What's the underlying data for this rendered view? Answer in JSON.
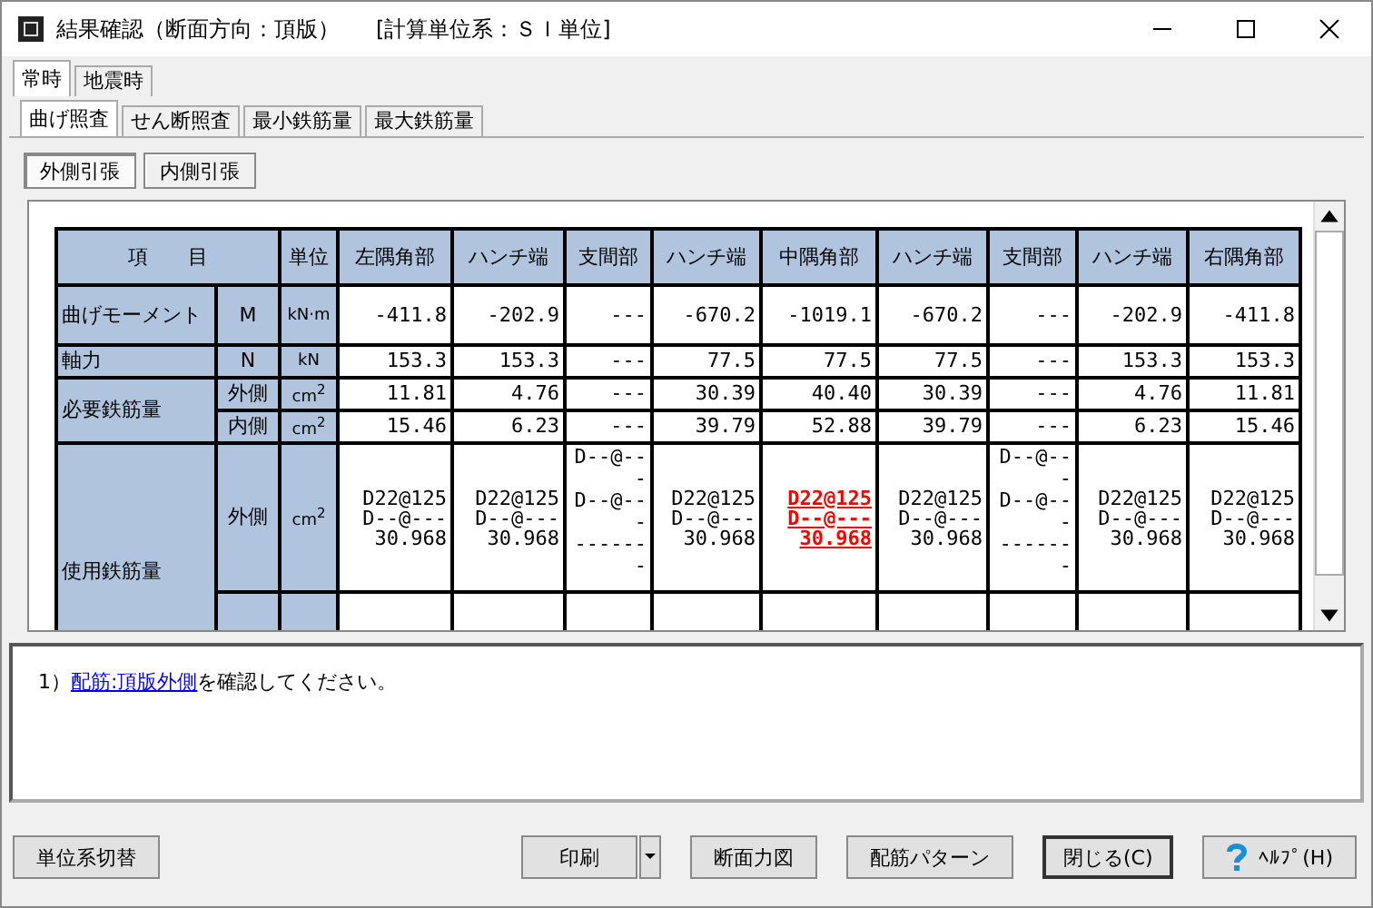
{
  "window": {
    "title": "結果確認（断面方向：頂版）",
    "units_note": "[計算単位系：ＳＩ単位]"
  },
  "tabs": [
    {
      "label": "常時",
      "selected": true
    },
    {
      "label": "地震時",
      "selected": false
    }
  ],
  "subtabs": [
    {
      "label": "曲げ照査",
      "selected": true
    },
    {
      "label": "せん断照査",
      "selected": false
    },
    {
      "label": "最小鉄筋量",
      "selected": false
    },
    {
      "label": "最大鉄筋量",
      "selected": false
    }
  ],
  "toggles": [
    {
      "label": "外側引張",
      "selected": true
    },
    {
      "label": "内側引張",
      "selected": false
    }
  ],
  "table": {
    "item_header": "項　　目",
    "unit_header": "単位",
    "columns": [
      "左隅角部",
      "ハンチ端",
      "支間部",
      "ハンチ端",
      "中隅角部",
      "ハンチ端",
      "支間部",
      "ハンチ端",
      "右隅角部"
    ],
    "groups": [
      {
        "label": "曲げモーメント",
        "subrows": [
          {
            "sub": "M",
            "unit": "kN·m",
            "values": [
              "-411.8",
              "-202.9",
              "---",
              "-670.2",
              "-1019.1",
              "-670.2",
              "---",
              "-202.9",
              "-411.8"
            ]
          }
        ]
      },
      {
        "label": "軸力",
        "subrows": [
          {
            "sub": "N",
            "unit": "kN",
            "values": [
              "153.3",
              "153.3",
              "---",
              "77.5",
              "77.5",
              "77.5",
              "---",
              "153.3",
              "153.3"
            ]
          }
        ]
      },
      {
        "label": "必要鉄筋量",
        "subrows": [
          {
            "sub": "外側",
            "unit": "cm$^{2}$",
            "values": [
              "11.81",
              "4.76",
              "---",
              "30.39",
              "40.40",
              "30.39",
              "---",
              "4.76",
              "11.81"
            ]
          },
          {
            "sub": "内側",
            "unit": "cm$^{2}$",
            "values": [
              "15.46",
              "6.23",
              "---",
              "39.79",
              "52.88",
              "39.79",
              "---",
              "6.23",
              "15.46"
            ]
          }
        ]
      },
      {
        "label": "使用鉄筋量",
        "subrows": [
          {
            "sub": "外側",
            "unit": "cm$^{2}$",
            "values": [
              {
                "lines": [
                  "D22@125",
                  "D--@---",
                  "30.968"
                ],
                "highlight": false
              },
              {
                "lines": [
                  "D22@125",
                  "D--@---",
                  "30.968"
                ],
                "highlight": false
              },
              {
                "lines": [
                  "D--@---",
                  "D--@---",
                  "-------"
                ],
                "highlight": false
              },
              {
                "lines": [
                  "D22@125",
                  "D--@---",
                  "30.968"
                ],
                "highlight": false
              },
              {
                "lines": [
                  "D22@125",
                  "D--@---",
                  "30.968"
                ],
                "highlight": true
              },
              {
                "lines": [
                  "D22@125",
                  "D--@---",
                  "30.968"
                ],
                "highlight": false
              },
              {
                "lines": [
                  "D--@---",
                  "D--@---",
                  "-------"
                ],
                "highlight": false
              },
              {
                "lines": [
                  "D22@125",
                  "D--@---",
                  "30.968"
                ],
                "highlight": false
              },
              {
                "lines": [
                  "D22@125",
                  "D--@---",
                  "30.968"
                ],
                "highlight": false
              }
            ]
          },
          {
            "values": []
          }
        ]
      }
    ]
  },
  "message": {
    "number": "1）",
    "link": "配筋:頂版外側",
    "text": "を確認してください。"
  },
  "buttons_left": [
    {
      "label": "単位系切替"
    }
  ],
  "buttons_right": [
    {
      "label": "印刷",
      "kind": "split"
    },
    {
      "label": "断面力図",
      "kind": "plain"
    },
    {
      "label": "配筋パターン",
      "kind": "plain"
    },
    {
      "label": "閉じる(C)",
      "kind": "default"
    },
    {
      "label": "ﾍﾙﾌﾟ(H)",
      "kind": "help"
    }
  ]
}
